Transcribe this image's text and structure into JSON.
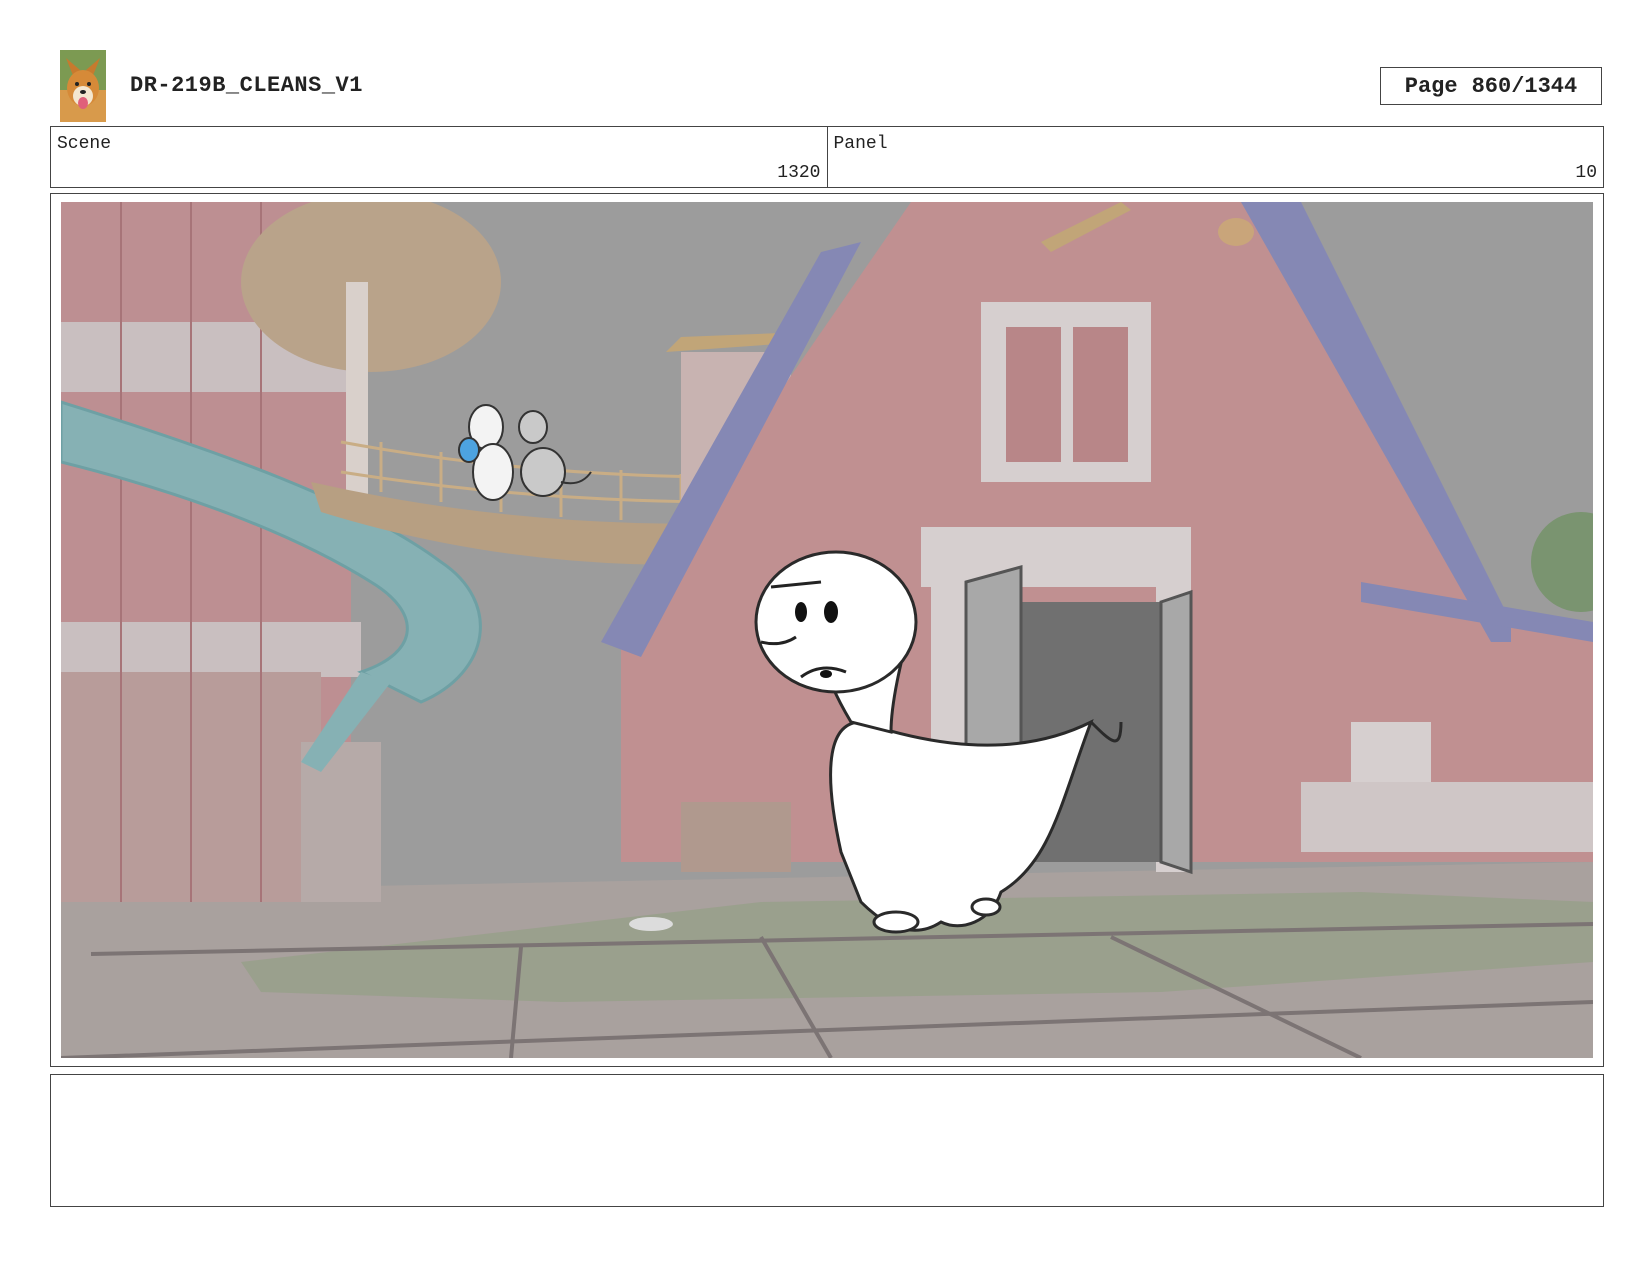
{
  "header": {
    "doc_title": "DR-219B_CLEANS_V1",
    "page_label": "Page",
    "page_value": "860/1344"
  },
  "info": {
    "scene_label": "Scene",
    "scene_value": "1320",
    "panel_label": "Panel",
    "panel_value": "10"
  },
  "notes": {
    "text": ""
  }
}
